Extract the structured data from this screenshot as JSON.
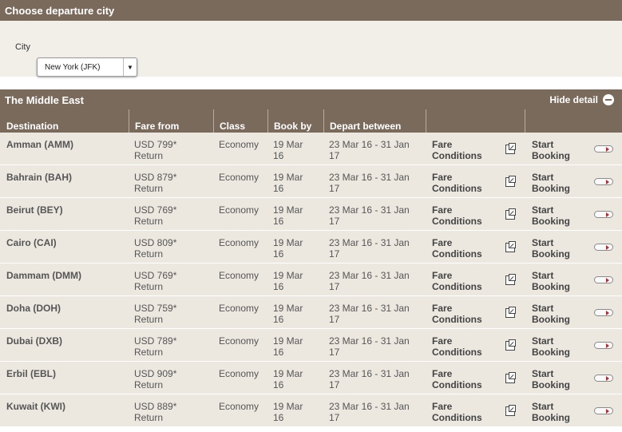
{
  "section1": {
    "title": "Choose departure city",
    "city_label": "City",
    "city_value": "New York (JFK)"
  },
  "section2": {
    "title": "The Middle East",
    "hide_detail": "Hide detail"
  },
  "table": {
    "headers": {
      "destination": "Destination",
      "fare_from": "Fare from",
      "class": "Class",
      "book_by": "Book by",
      "depart_between": "Depart between"
    },
    "rows": [
      {
        "destination": "Amman (AMM)",
        "fare": "USD 799*",
        "fare_type": "Return",
        "class": "Economy",
        "book_by_1": "19 Mar",
        "book_by_2": "16",
        "depart_1": "23 Mar 16 - 31 Jan",
        "depart_2": "17",
        "fare_cond_1": "Fare",
        "fare_cond_2": "Conditions",
        "start_1": "Start",
        "start_2": "Booking"
      },
      {
        "destination": "Bahrain (BAH)",
        "fare": "USD 879*",
        "fare_type": "Return",
        "class": "Economy",
        "book_by_1": "19 Mar",
        "book_by_2": "16",
        "depart_1": "23 Mar 16 - 31 Jan",
        "depart_2": "17",
        "fare_cond_1": "Fare",
        "fare_cond_2": "Conditions",
        "start_1": "Start",
        "start_2": "Booking"
      },
      {
        "destination": "Beirut (BEY)",
        "fare": "USD 769*",
        "fare_type": "Return",
        "class": "Economy",
        "book_by_1": "19 Mar",
        "book_by_2": "16",
        "depart_1": "23 Mar 16 - 31 Jan",
        "depart_2": "17",
        "fare_cond_1": "Fare",
        "fare_cond_2": "Conditions",
        "start_1": "Start",
        "start_2": "Booking"
      },
      {
        "destination": "Cairo (CAI)",
        "fare": "USD 809*",
        "fare_type": "Return",
        "class": "Economy",
        "book_by_1": "19 Mar",
        "book_by_2": "16",
        "depart_1": "23 Mar 16 - 31 Jan",
        "depart_2": "17",
        "fare_cond_1": "Fare",
        "fare_cond_2": "Conditions",
        "start_1": "Start",
        "start_2": "Booking"
      },
      {
        "destination": "Dammam (DMM)",
        "fare": "USD 769*",
        "fare_type": "Return",
        "class": "Economy",
        "book_by_1": "19 Mar",
        "book_by_2": "16",
        "depart_1": "23 Mar 16 - 31 Jan",
        "depart_2": "17",
        "fare_cond_1": "Fare",
        "fare_cond_2": "Conditions",
        "start_1": "Start",
        "start_2": "Booking"
      },
      {
        "destination": "Doha (DOH)",
        "fare": "USD 759*",
        "fare_type": "Return",
        "class": "Economy",
        "book_by_1": "19 Mar",
        "book_by_2": "16",
        "depart_1": "23 Mar 16 - 31 Jan",
        "depart_2": "17",
        "fare_cond_1": "Fare",
        "fare_cond_2": "Conditions",
        "start_1": "Start",
        "start_2": "Booking"
      },
      {
        "destination": "Dubai (DXB)",
        "fare": "USD 789*",
        "fare_type": "Return",
        "class": "Economy",
        "book_by_1": "19 Mar",
        "book_by_2": "16",
        "depart_1": "23 Mar 16 - 31 Jan",
        "depart_2": "17",
        "fare_cond_1": "Fare",
        "fare_cond_2": "Conditions",
        "start_1": "Start",
        "start_2": "Booking"
      },
      {
        "destination": "Erbil (EBL)",
        "fare": "USD 909*",
        "fare_type": "Return",
        "class": "Economy",
        "book_by_1": "19 Mar",
        "book_by_2": "16",
        "depart_1": "23 Mar 16 - 31 Jan",
        "depart_2": "17",
        "fare_cond_1": "Fare",
        "fare_cond_2": "Conditions",
        "start_1": "Start",
        "start_2": "Booking"
      },
      {
        "destination": "Kuwait (KWI)",
        "fare": "USD 889*",
        "fare_type": "Return",
        "class": "Economy",
        "book_by_1": "19 Mar",
        "book_by_2": "16",
        "depart_1": "23 Mar 16 - 31 Jan",
        "depart_2": "17",
        "fare_cond_1": "Fare",
        "fare_cond_2": "Conditions",
        "start_1": "Start",
        "start_2": "Booking"
      }
    ]
  },
  "icons": {
    "fare_conditions": "external-link-icon",
    "start_booking": "arrow-right-icon",
    "hide_detail": "minus-circle-icon",
    "select": "dropdown-arrow-icon"
  },
  "colors": {
    "header_bar": "#7a6a5c",
    "panel_bg": "#f2efe9",
    "row_bg": "#ece8e0",
    "arrow_accent": "#c1272d"
  }
}
